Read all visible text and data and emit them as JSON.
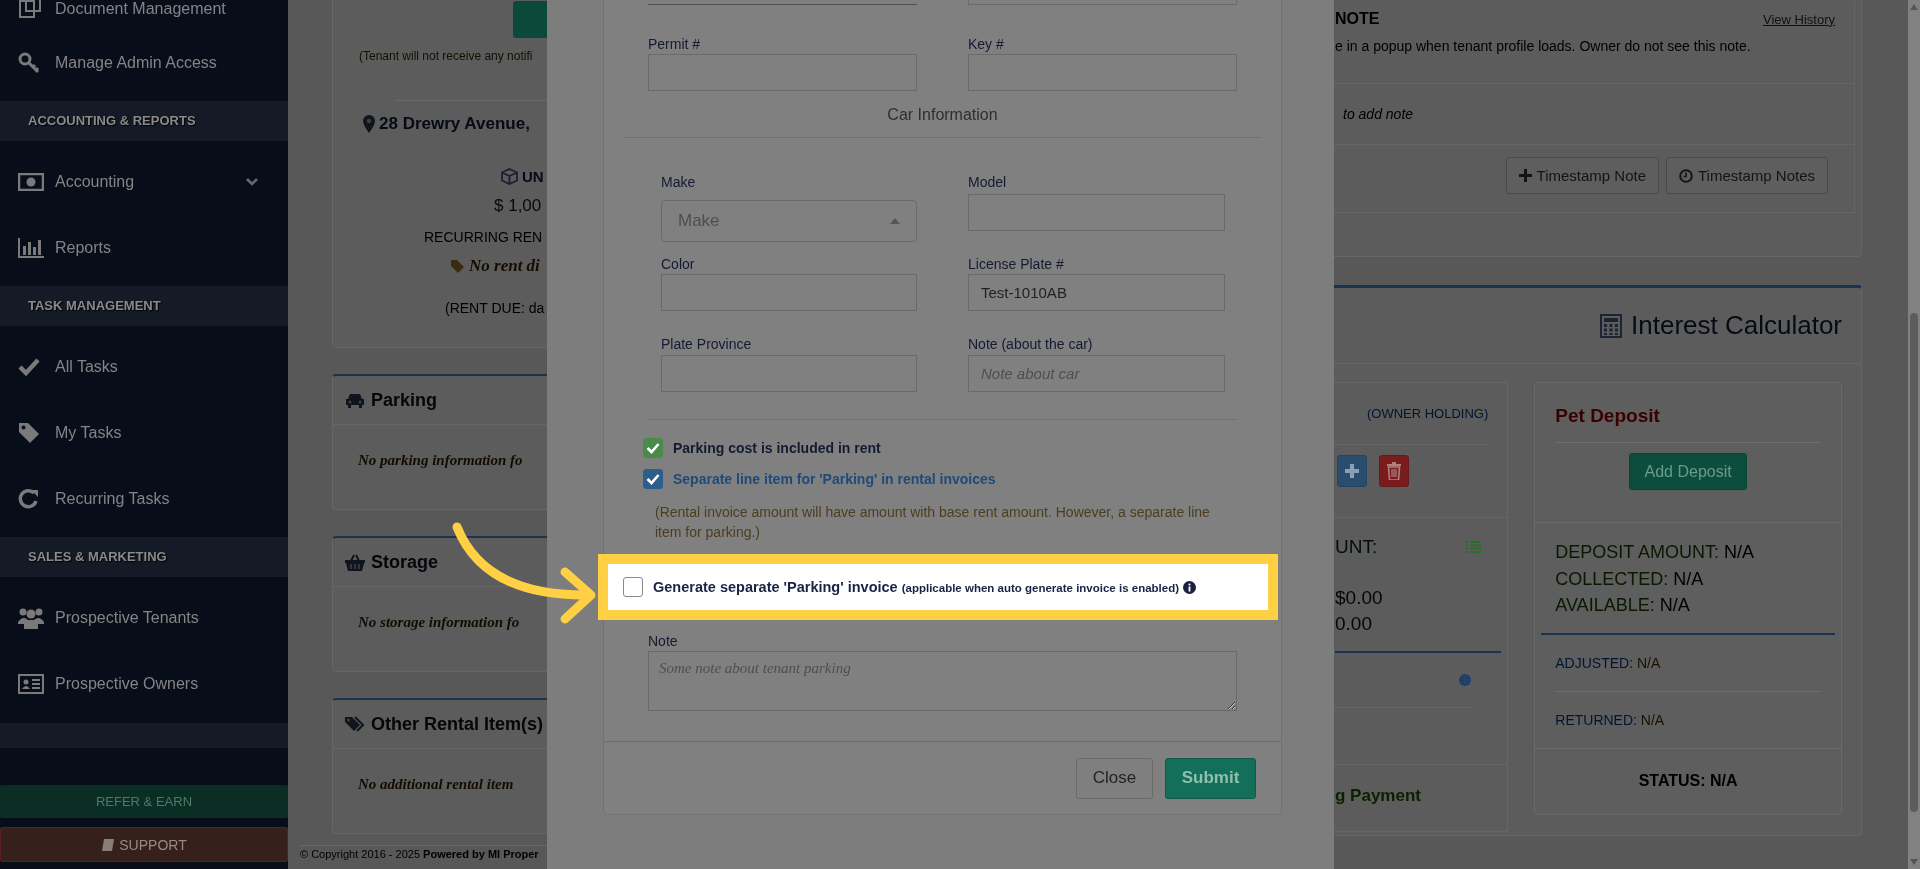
{
  "sidebar": {
    "items": [
      {
        "kind": "link",
        "label": "Document Management"
      },
      {
        "kind": "link",
        "label": "Manage Admin Access"
      },
      {
        "kind": "header",
        "label": "ACCOUNTING & REPORTS"
      },
      {
        "kind": "submenu",
        "label": "Accounting",
        "expanded": false
      },
      {
        "kind": "link",
        "label": "Reports"
      },
      {
        "kind": "header",
        "label": "TASK MANAGEMENT"
      },
      {
        "kind": "link",
        "label": "All Tasks"
      },
      {
        "kind": "link",
        "label": "My Tasks"
      },
      {
        "kind": "link",
        "label": "Recurring Tasks"
      },
      {
        "kind": "header",
        "label": "SALES & MARKETING"
      },
      {
        "kind": "link",
        "label": "Prospective Tenants"
      },
      {
        "kind": "link",
        "label": "Prospective Owners"
      },
      {
        "kind": "band"
      }
    ],
    "buttons": [
      {
        "kind": "success",
        "label": "REFER & EARN"
      },
      {
        "kind": "danger",
        "label": "SUPPORT"
      }
    ]
  },
  "tenant_card": {
    "notice": "(Tenant will not receive any notifi",
    "address": "28 Drewry Avenue,",
    "unit": "UN",
    "rent": "$ 1,00",
    "rent_label": "RECURRING REN",
    "discount": "No rent di",
    "due": "(RENT DUE: da"
  },
  "rental_cards": [
    {
      "title": "Parking",
      "message": "No parking information fo"
    },
    {
      "title": "Storage",
      "message": "No storage information fo"
    },
    {
      "title": "Other Rental Item(s)",
      "message": "No additional rental item"
    }
  ],
  "footer": "© Copyright 2016 - 2025 **Powered by MI Proper**",
  "modal": {
    "top_fields": [
      {
        "label": "Permit #"
      },
      {
        "label": "Key #"
      }
    ],
    "section_title": "Car Information",
    "car_fields": [
      {
        "kind": "select",
        "label": "Make",
        "placeholder": "Make"
      },
      {
        "kind": "text",
        "label": "Model"
      },
      {
        "kind": "text",
        "label": "Color"
      },
      {
        "kind": "text",
        "label": "License Plate #",
        "value": "Test-1010AB"
      },
      {
        "kind": "text",
        "label": "Plate Province"
      },
      {
        "kind": "text",
        "label": "Note (about the car)",
        "placeholder": "Note about car"
      }
    ],
    "checkboxes": [
      {
        "kind": "success",
        "label": "Parking cost is included in rent",
        "checked": true
      },
      {
        "kind": "primary",
        "label": "Separate line item for 'Parking' in rental invoices",
        "checked": true
      }
    ],
    "checkbox_hint": "(Rental invoice amount will have amount with base rent amount. However, a separate line item for parking.)",
    "invoice_option": {
      "label": "Generate separate 'Parking' invoice",
      "note": "(applicable when auto generate invoice is enabled)",
      "checked": false
    },
    "note": {
      "label": "Note",
      "placeholder": "Some note about tenant parking"
    },
    "buttons": [
      {
        "kind": "default",
        "label": "Close"
      },
      {
        "kind": "primary",
        "label": "Submit"
      }
    ]
  },
  "note_card": {
    "title": "NOTE",
    "history_link": "View History",
    "description": "e in a popup when tenant profile loads. Owner do not see this note.",
    "prompt": "to add note",
    "buttons": [
      {
        "label": "Timestamp Note"
      },
      {
        "label": "Timestamp Notes"
      }
    ]
  },
  "interest_calculator": {
    "title": "Interest Calculator",
    "holding": {
      "tag": "(OWNER HOLDING)",
      "amount_label": "UNT:",
      "values": [
        "$0.00",
        "0.00"
      ],
      "payment": "g Payment"
    },
    "pet_deposit": {
      "title": "Pet Deposit",
      "button": "Add Deposit",
      "summary": [
        {
          "label": "DEPOSIT AMOUNT:",
          "value": "N/A"
        },
        {
          "label": "COLLECTED:",
          "value": "N/A"
        },
        {
          "label": "AVAILABLE:",
          "value": "N/A"
        }
      ],
      "details": [
        {
          "label": "ADJUSTED:",
          "value": "N/A"
        },
        {
          "label": "RETURNED:",
          "value": "N/A"
        }
      ],
      "status": "STATUS: N/A"
    }
  }
}
